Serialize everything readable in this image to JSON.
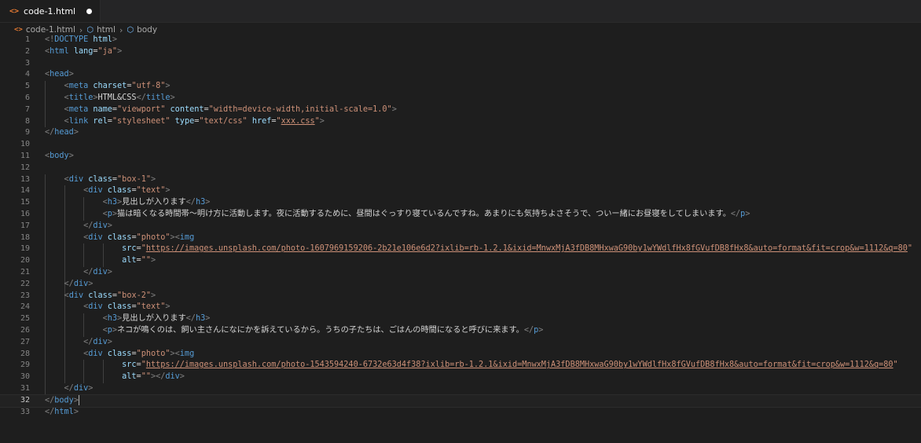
{
  "tab": {
    "filename": "code-1.html",
    "icon": "html-file-icon",
    "modified": true
  },
  "breadcrumb": [
    "code-1.html",
    "html",
    "body"
  ],
  "editor": {
    "current_line": 32,
    "lines": [
      [
        [
          "p",
          "<!"
        ],
        [
          "t",
          "DOCTYPE"
        ],
        [
          "tx",
          " "
        ],
        [
          "a",
          "html"
        ],
        [
          "p",
          ">"
        ]
      ],
      [
        [
          "p",
          "<"
        ],
        [
          "t",
          "html"
        ],
        [
          "tx",
          " "
        ],
        [
          "a",
          "lang"
        ],
        [
          "tx",
          "="
        ],
        [
          "s",
          "\"ja\""
        ],
        [
          "p",
          ">"
        ]
      ],
      [],
      [
        [
          "p",
          "<"
        ],
        [
          "t",
          "head"
        ],
        [
          "p",
          ">"
        ]
      ],
      [
        [
          "tx",
          "    "
        ],
        [
          "p",
          "<"
        ],
        [
          "t",
          "meta"
        ],
        [
          "tx",
          " "
        ],
        [
          "a",
          "charset"
        ],
        [
          "tx",
          "="
        ],
        [
          "s",
          "\"utf-8\""
        ],
        [
          "p",
          ">"
        ]
      ],
      [
        [
          "tx",
          "    "
        ],
        [
          "p",
          "<"
        ],
        [
          "t",
          "title"
        ],
        [
          "p",
          ">"
        ],
        [
          "tx",
          "HTML&CSS"
        ],
        [
          "p",
          "</"
        ],
        [
          "t",
          "title"
        ],
        [
          "p",
          ">"
        ]
      ],
      [
        [
          "tx",
          "    "
        ],
        [
          "p",
          "<"
        ],
        [
          "t",
          "meta"
        ],
        [
          "tx",
          " "
        ],
        [
          "a",
          "name"
        ],
        [
          "tx",
          "="
        ],
        [
          "s",
          "\"viewport\""
        ],
        [
          "tx",
          " "
        ],
        [
          "a",
          "content"
        ],
        [
          "tx",
          "="
        ],
        [
          "s",
          "\"width=device-width,initial-scale=1.0\""
        ],
        [
          "p",
          ">"
        ]
      ],
      [
        [
          "tx",
          "    "
        ],
        [
          "p",
          "<"
        ],
        [
          "t",
          "link"
        ],
        [
          "tx",
          " "
        ],
        [
          "a",
          "rel"
        ],
        [
          "tx",
          "="
        ],
        [
          "s",
          "\"stylesheet\""
        ],
        [
          "tx",
          " "
        ],
        [
          "a",
          "type"
        ],
        [
          "tx",
          "="
        ],
        [
          "s",
          "\"text/css\""
        ],
        [
          "tx",
          " "
        ],
        [
          "a",
          "href"
        ],
        [
          "tx",
          "="
        ],
        [
          "s",
          "\""
        ],
        [
          "su",
          "xxx.css"
        ],
        [
          "s",
          "\""
        ],
        [
          "p",
          ">"
        ]
      ],
      [
        [
          "p",
          "</"
        ],
        [
          "t",
          "head"
        ],
        [
          "p",
          ">"
        ]
      ],
      [],
      [
        [
          "p",
          "<"
        ],
        [
          "t",
          "body"
        ],
        [
          "p",
          ">"
        ]
      ],
      [],
      [
        [
          "tx",
          "    "
        ],
        [
          "p",
          "<"
        ],
        [
          "t",
          "div"
        ],
        [
          "tx",
          " "
        ],
        [
          "a",
          "class"
        ],
        [
          "tx",
          "="
        ],
        [
          "s",
          "\"box-1\""
        ],
        [
          "p",
          ">"
        ]
      ],
      [
        [
          "tx",
          "        "
        ],
        [
          "p",
          "<"
        ],
        [
          "t",
          "div"
        ],
        [
          "tx",
          " "
        ],
        [
          "a",
          "class"
        ],
        [
          "tx",
          "="
        ],
        [
          "s",
          "\"text\""
        ],
        [
          "p",
          ">"
        ]
      ],
      [
        [
          "tx",
          "            "
        ],
        [
          "p",
          "<"
        ],
        [
          "t",
          "h3"
        ],
        [
          "p",
          ">"
        ],
        [
          "tx",
          "見出しが入ります"
        ],
        [
          "p",
          "</"
        ],
        [
          "t",
          "h3"
        ],
        [
          "p",
          ">"
        ]
      ],
      [
        [
          "tx",
          "            "
        ],
        [
          "p",
          "<"
        ],
        [
          "t",
          "p"
        ],
        [
          "p",
          ">"
        ],
        [
          "tx",
          "猫は暗くなる時間帯〜明け方に活動します。夜に活動するために、昼間はぐっすり寝ているんですね。あまりにも気持ちよさそうで、ついー緒にお昼寝をしてしまいます。"
        ],
        [
          "p",
          "</"
        ],
        [
          "t",
          "p"
        ],
        [
          "p",
          ">"
        ]
      ],
      [
        [
          "tx",
          "        "
        ],
        [
          "p",
          "</"
        ],
        [
          "t",
          "div"
        ],
        [
          "p",
          ">"
        ]
      ],
      [
        [
          "tx",
          "        "
        ],
        [
          "p",
          "<"
        ],
        [
          "t",
          "div"
        ],
        [
          "tx",
          " "
        ],
        [
          "a",
          "class"
        ],
        [
          "tx",
          "="
        ],
        [
          "s",
          "\"photo\""
        ],
        [
          "p",
          ">"
        ],
        [
          "p",
          "<"
        ],
        [
          "t",
          "img"
        ]
      ],
      [
        [
          "tx",
          "                "
        ],
        [
          "a",
          "src"
        ],
        [
          "tx",
          "="
        ],
        [
          "s",
          "\""
        ],
        [
          "su",
          "https://images.unsplash.com/photo-1607969159206-2b21e106e6d2?ixlib=rb-1.2.1&ixid=MnwxMjA3fDB8MHxwaG90by1wYWdlfHx8fGVufDB8fHx8&auto=format&fit=crop&w=1112&q=80"
        ],
        [
          "s",
          "\""
        ]
      ],
      [
        [
          "tx",
          "                "
        ],
        [
          "a",
          "alt"
        ],
        [
          "tx",
          "="
        ],
        [
          "s",
          "\"\""
        ],
        [
          "p",
          ">"
        ]
      ],
      [
        [
          "tx",
          "        "
        ],
        [
          "p",
          "</"
        ],
        [
          "t",
          "div"
        ],
        [
          "p",
          ">"
        ]
      ],
      [
        [
          "tx",
          "    "
        ],
        [
          "p",
          "</"
        ],
        [
          "t",
          "div"
        ],
        [
          "p",
          ">"
        ]
      ],
      [
        [
          "tx",
          "    "
        ],
        [
          "p",
          "<"
        ],
        [
          "t",
          "div"
        ],
        [
          "tx",
          " "
        ],
        [
          "a",
          "class"
        ],
        [
          "tx",
          "="
        ],
        [
          "s",
          "\"box-2\""
        ],
        [
          "p",
          ">"
        ]
      ],
      [
        [
          "tx",
          "        "
        ],
        [
          "p",
          "<"
        ],
        [
          "t",
          "div"
        ],
        [
          "tx",
          " "
        ],
        [
          "a",
          "class"
        ],
        [
          "tx",
          "="
        ],
        [
          "s",
          "\"text\""
        ],
        [
          "p",
          ">"
        ]
      ],
      [
        [
          "tx",
          "            "
        ],
        [
          "p",
          "<"
        ],
        [
          "t",
          "h3"
        ],
        [
          "p",
          ">"
        ],
        [
          "tx",
          "見出しが入ります"
        ],
        [
          "p",
          "</"
        ],
        [
          "t",
          "h3"
        ],
        [
          "p",
          ">"
        ]
      ],
      [
        [
          "tx",
          "            "
        ],
        [
          "p",
          "<"
        ],
        [
          "t",
          "p"
        ],
        [
          "p",
          ">"
        ],
        [
          "tx",
          "ネコが鳴くのは、飼い主さんになにかを訴えているから。うちの子たちは、ごはんの時間になると呼びに来ます。"
        ],
        [
          "p",
          "</"
        ],
        [
          "t",
          "p"
        ],
        [
          "p",
          ">"
        ]
      ],
      [
        [
          "tx",
          "        "
        ],
        [
          "p",
          "</"
        ],
        [
          "t",
          "div"
        ],
        [
          "p",
          ">"
        ]
      ],
      [
        [
          "tx",
          "        "
        ],
        [
          "p",
          "<"
        ],
        [
          "t",
          "div"
        ],
        [
          "tx",
          " "
        ],
        [
          "a",
          "class"
        ],
        [
          "tx",
          "="
        ],
        [
          "s",
          "\"photo\""
        ],
        [
          "p",
          ">"
        ],
        [
          "p",
          "<"
        ],
        [
          "t",
          "img"
        ]
      ],
      [
        [
          "tx",
          "                "
        ],
        [
          "a",
          "src"
        ],
        [
          "tx",
          "="
        ],
        [
          "s",
          "\""
        ],
        [
          "su",
          "https://images.unsplash.com/photo-1543594240-6732e63d4f38?ixlib=rb-1.2.1&ixid=MnwxMjA3fDB8MHxwaG90by1wYWdlfHx8fGVufDB8fHx8&auto=format&fit=crop&w=1112&q=80"
        ],
        [
          "s",
          "\""
        ]
      ],
      [
        [
          "tx",
          "                "
        ],
        [
          "a",
          "alt"
        ],
        [
          "tx",
          "="
        ],
        [
          "s",
          "\"\""
        ],
        [
          "p",
          ">"
        ],
        [
          "p",
          "</"
        ],
        [
          "t",
          "div"
        ],
        [
          "p",
          ">"
        ]
      ],
      [
        [
          "tx",
          "    "
        ],
        [
          "p",
          "</"
        ],
        [
          "t",
          "div"
        ],
        [
          "p",
          ">"
        ]
      ],
      [
        [
          "p",
          "</"
        ],
        [
          "t",
          "body"
        ],
        [
          "p",
          ">"
        ]
      ],
      [
        [
          "p",
          "</"
        ],
        [
          "t",
          "html"
        ],
        [
          "p",
          ">"
        ]
      ]
    ]
  }
}
